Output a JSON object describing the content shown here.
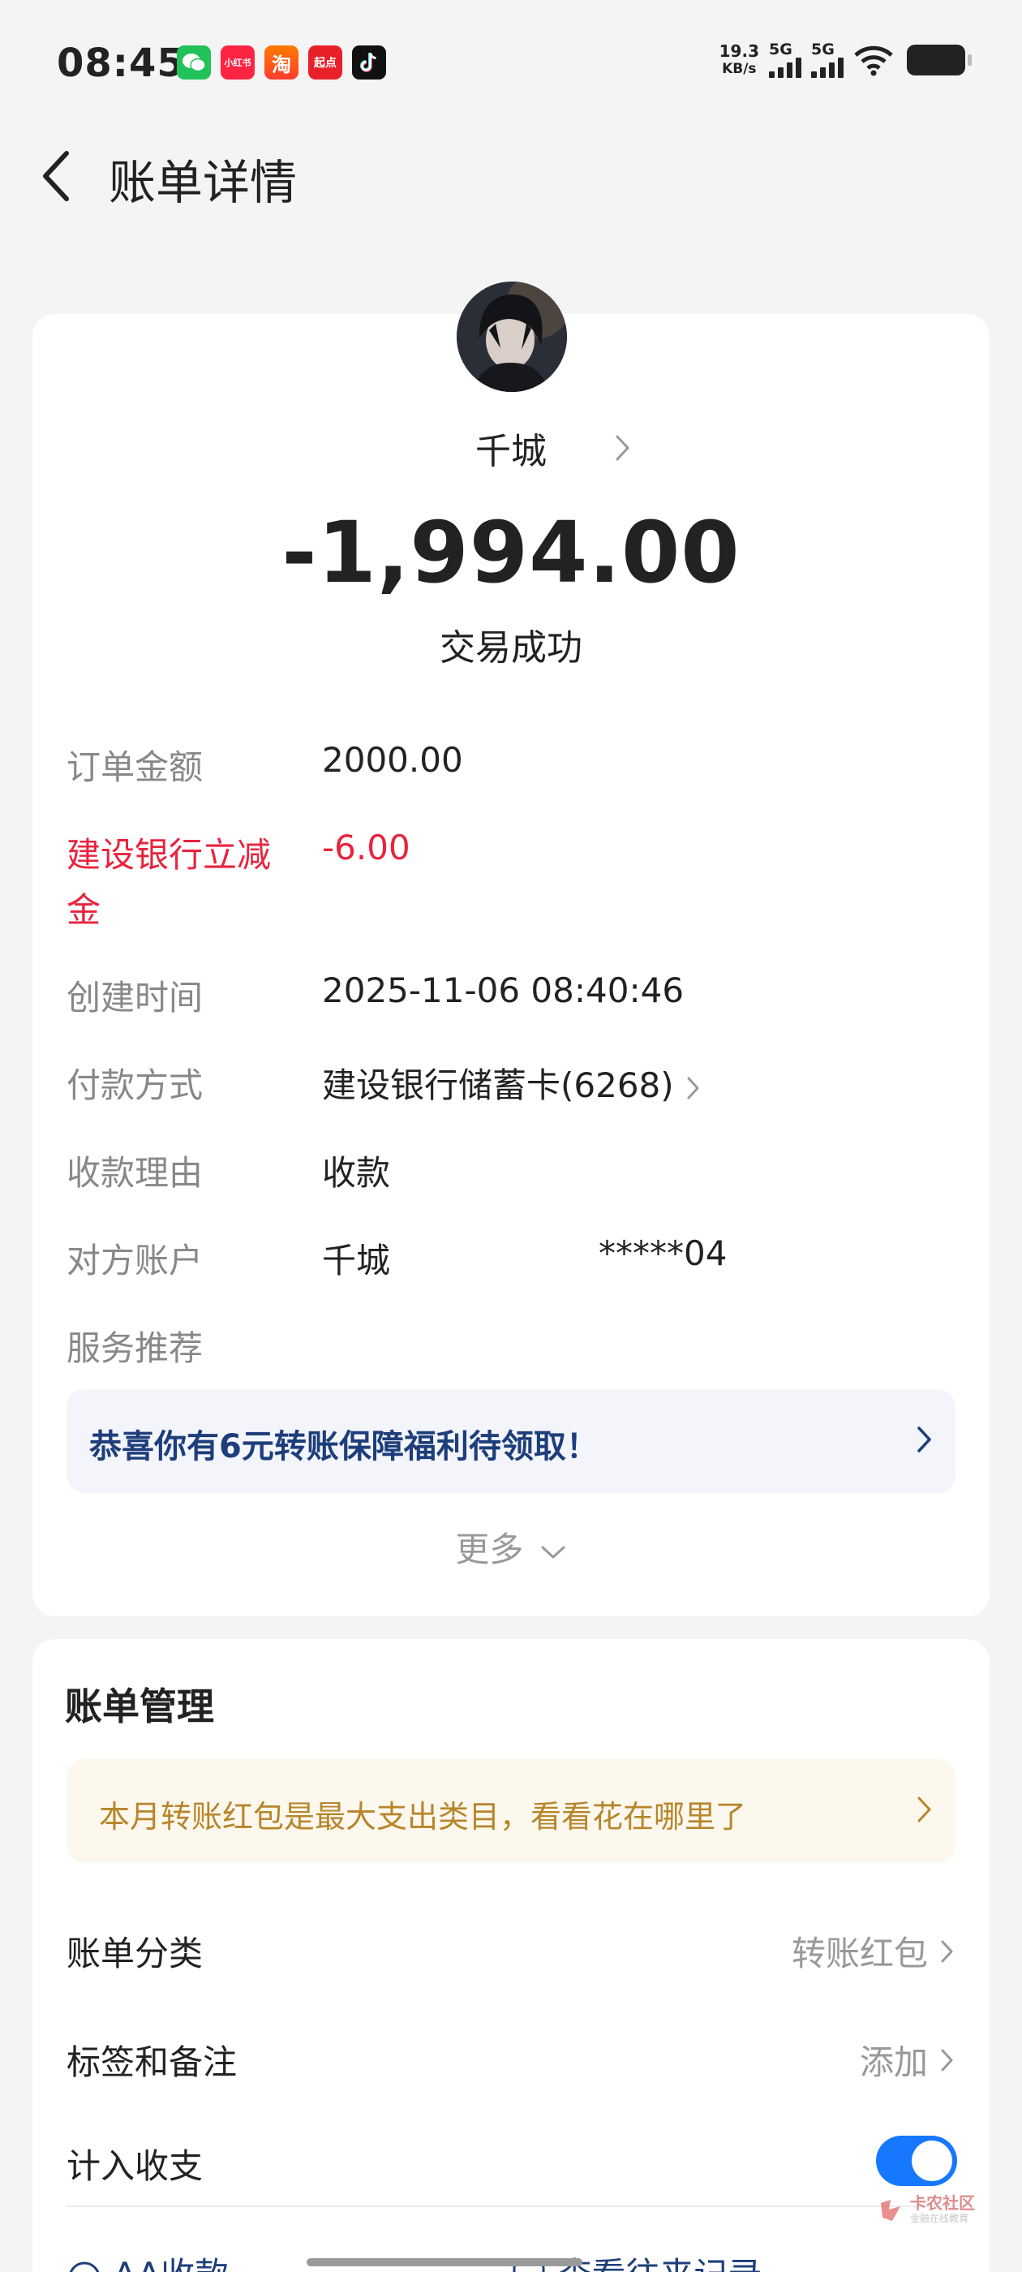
{
  "status_bar": {
    "time": "08:45",
    "net_speed_value": "19.3",
    "net_speed_unit": "KB/s",
    "signal1": "5G",
    "signal2": "5G",
    "app_icons": [
      "wechat-icon",
      "xiaohongshu-icon",
      "taobao-icon",
      "qidian-icon",
      "douyin-icon"
    ],
    "xhs_label": "小红书",
    "qidian_label": "起点",
    "taobao_label": "淘"
  },
  "header": {
    "title": "账单详情",
    "back_icon": "chevron-left-icon"
  },
  "transaction": {
    "payee_name": "千城",
    "amount": "-1,994.00",
    "status": "交易成功"
  },
  "details": {
    "order_amount_label": "订单金额",
    "order_amount_value": "2000.00",
    "discount_label_line1": "建设银行立减",
    "discount_label_line2": "金",
    "discount_value": "-6.00",
    "created_label": "创建时间",
    "created_value": "2025-11-06 08:40:46",
    "payment_label": "付款方式",
    "payment_value": "建设银行储蓄卡(6268)",
    "reason_label": "收款理由",
    "reason_value": "收款",
    "account_label": "对方账户",
    "account_name": "千城",
    "account_masked": "*****04",
    "service_label": "服务推荐"
  },
  "promo_blue": "恭喜你有6元转账保障福利待领取！",
  "more_label": "更多",
  "manage": {
    "title": "账单管理",
    "promo": "本月转账红包是最大支出类目，看看花在哪里了",
    "category_label": "账单分类",
    "category_value": "转账红包",
    "tags_label": "标签和备注",
    "tags_value": "添加",
    "include_label": "计入收支",
    "include_on": true,
    "aa_label": "AA收款",
    "history_label": "查看往来记录"
  },
  "watermark": {
    "text": "卡农社区",
    "sub": "金融在线教育"
  },
  "colors": {
    "accent_blue": "#1677ff",
    "discount_red": "#e8243f",
    "promo_orange_text": "#b7862b",
    "promo_blue_text": "#1d3e7a"
  }
}
